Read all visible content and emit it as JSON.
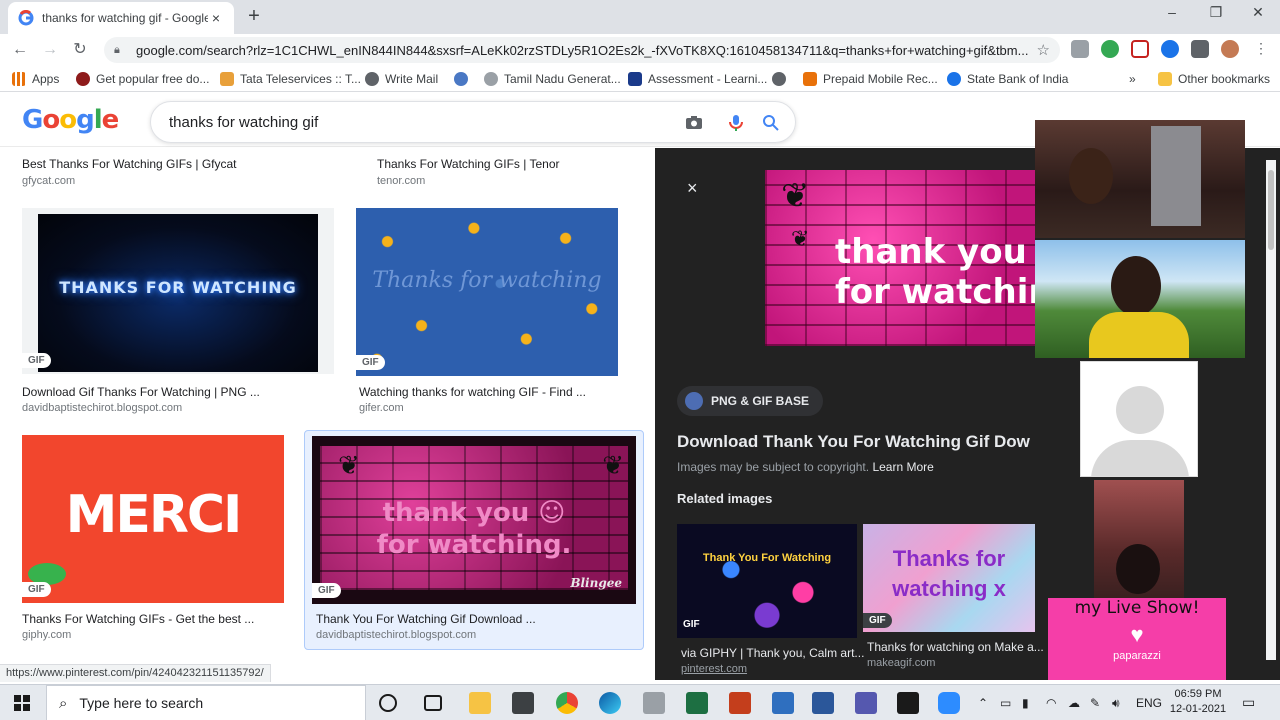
{
  "browser": {
    "tab_title": "thanks for watching gif - Google",
    "tab_close": "×",
    "new_tab": "+",
    "url": "google.com/search?rlz=1C1CHWL_enIN844IN844&sxsrf=ALeKk02rzSTDLy5R1O2Es2k_-fXVoTK8XQ:1610458134711&q=thanks+for+watching+gif&tbm...",
    "window": {
      "minimize": "–",
      "maximize": "❐",
      "close": "✕"
    }
  },
  "bookmarks": [
    {
      "label": "Apps",
      "color": "#e8710a"
    },
    {
      "label": "Get popular free do...",
      "color": "#8e1b1b"
    },
    {
      "label": "Tata Teleservices :: T...",
      "color": "#e8a03a"
    },
    {
      "label": "Write Mail",
      "color": "#5f6368"
    },
    {
      "label": "",
      "color": "#4a78c4"
    },
    {
      "label": "Tamil Nadu Generat...",
      "color": "#9aa0a6"
    },
    {
      "label": "Assessment - Learni...",
      "color": "#1a3a8a"
    },
    {
      "label": "",
      "color": "#5f6368"
    },
    {
      "label": "Prepaid Mobile Rec...",
      "color": "#e8710a"
    },
    {
      "label": "State Bank of India",
      "color": "#1a73e8"
    },
    {
      "label": "»",
      "color": ""
    },
    {
      "label": "Other bookmarks",
      "color": "#f6c344"
    }
  ],
  "search": {
    "query": "thanks for watching gif"
  },
  "results": {
    "top_left": {
      "title": "Best Thanks For Watching GIFs | Gfycat",
      "source": "gfycat.com"
    },
    "top_right": {
      "title": "Thanks For Watching GIFs | Tenor",
      "source": "tenor.com"
    },
    "row1_left": {
      "title": "Download Gif Thanks For Watching | PNG ...",
      "source": "davidbaptistechirot.blogspot.com",
      "badge": "GIF",
      "thumb_text": "THANKS FOR WATCHING"
    },
    "row1_right": {
      "title": "Watching thanks for watching GIF - Find ...",
      "source": "gifer.com",
      "badge": "GIF",
      "thumb_text": "Thanks for watching"
    },
    "row2_left": {
      "title": "Thanks For Watching GIFs - Get the best ...",
      "source": "giphy.com",
      "badge": "GIF",
      "thumb_text": "MERCI"
    },
    "row2_right": {
      "title": "Thank You For Watching Gif Download ...",
      "source": "davidbaptistechirot.blogspot.com",
      "badge": "GIF",
      "thumb_text_1": "thank you ☺",
      "thumb_text_2": "for watching.",
      "thumb_sig": "Blingee"
    }
  },
  "panel": {
    "close": "×",
    "image_text_1": "thank you",
    "image_text_2": "for watchin",
    "site_pill": "PNG & GIF BASE",
    "title": "Download Thank You For Watching Gif Dow",
    "copyright": "Images may be subject to copyright.",
    "learn_more": "Learn More",
    "related_heading": "Related images",
    "related": [
      {
        "thumb_text": "Thank You For Watching",
        "badge": "GIF",
        "caption": "via GIPHY | Thank you, Calm art...",
        "source": "pinterest.com"
      },
      {
        "thumb_text": "Thanks for watching x",
        "badge": "GIF",
        "caption": "Thanks for watching on Make a...",
        "source": "makeagif.com"
      }
    ]
  },
  "video_overlay": {
    "tile_text": "my Live Show!",
    "tile_sub": "paparazzi"
  },
  "status_url": "https://www.pinterest.com/pin/424042321151135792/",
  "taskbar": {
    "search_placeholder": "Type here to search",
    "language": "ENG",
    "time": "06:59 PM",
    "date": "12-01-2021"
  }
}
